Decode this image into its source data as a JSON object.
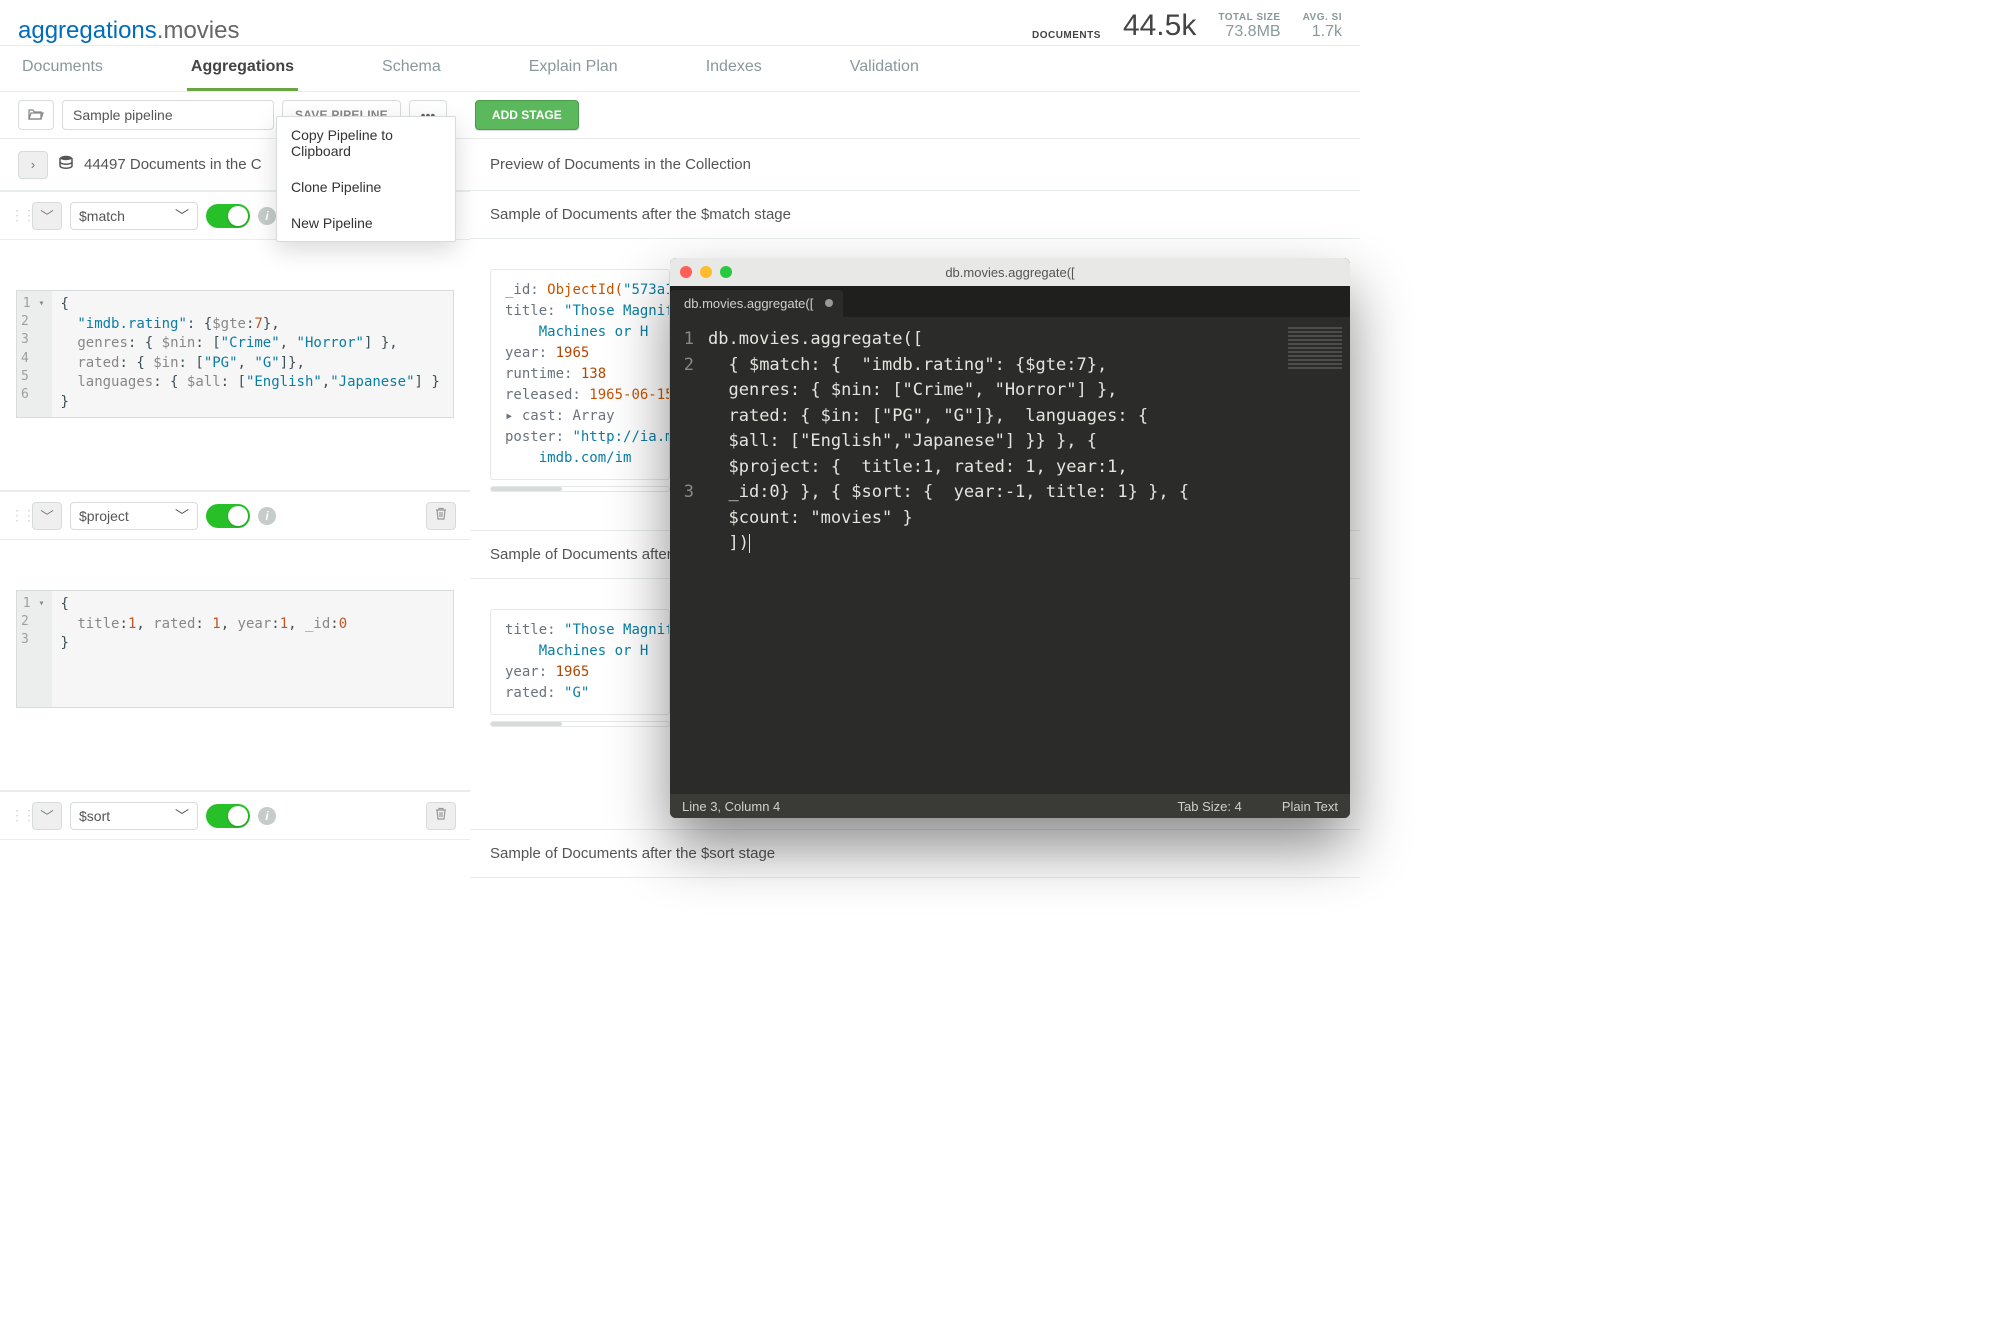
{
  "header": {
    "db": "aggregations",
    "collection": "movies",
    "stats": {
      "documents_label": "DOCUMENTS",
      "documents_value": "44.5k",
      "total_size_label": "TOTAL SIZE",
      "total_size_value": "73.8MB",
      "avg_size_label": "AVG. SI",
      "avg_size_value": "1.7k"
    }
  },
  "tabs": [
    "Documents",
    "Aggregations",
    "Schema",
    "Explain Plan",
    "Indexes",
    "Validation"
  ],
  "active_tab": "Aggregations",
  "toolbar": {
    "pipeline_name": "Sample pipeline",
    "save_label": "SAVE PIPELINE",
    "add_stage_label": "ADD STAGE",
    "dropdown": [
      "Copy Pipeline to Clipboard",
      "Clone Pipeline",
      "New Pipeline"
    ]
  },
  "doc_header": {
    "left": "44497 Documents in the C",
    "right": "Preview of Documents in the Collection"
  },
  "stages": [
    {
      "operator": "$match",
      "sample_label": "Sample of Documents after the $match stage",
      "editor_lines": [
        "{",
        "  \"imdb.rating\": {$gte:7},",
        "  genres: { $nin: [\"Crime\", \"Horror\"] },",
        "  rated: { $in: [\"PG\", \"G\"]},",
        "  languages: { $all: [\"English\",\"Japanese\"] }",
        "}"
      ],
      "preview": {
        "id_label": "_id:",
        "id_fn": "ObjectId(",
        "id_val": "\"573a1",
        "title_label": "title:",
        "title_val": "\"Those Magnif",
        "title_cont": "Machines or H",
        "year_label": "year:",
        "year_val": "1965",
        "runtime_label": "runtime:",
        "runtime_val": "138",
        "released_label": "released:",
        "released_val": "1965-06-15",
        "cast_label": "cast:",
        "cast_val": "Array",
        "poster_label": "poster:",
        "poster_val": "\"http://ia.m",
        "poster_cont": "imdb.com/im"
      }
    },
    {
      "operator": "$project",
      "sample_label": "Sample of Documents after the",
      "editor_lines": [
        "{",
        "  title:1, rated: 1, year:1, _id:0",
        "}"
      ],
      "preview": {
        "title_label": "title:",
        "title_val": "\"Those Magnif",
        "title_cont": "Machines or H",
        "year_label": "year:",
        "year_val": "1965",
        "rated_label": "rated:",
        "rated_val": "\"G\""
      }
    },
    {
      "operator": "$sort",
      "sample_label": "Sample of Documents after the $sort stage"
    }
  ],
  "editor_window": {
    "title": "db.movies.aggregate([",
    "tab": "db.movies.aggregate([",
    "gutter": [
      "1",
      "2",
      "",
      "",
      "",
      "",
      "",
      "3"
    ],
    "code": "db.movies.aggregate([\n  { $match: {  \"imdb.rating\": {$gte:7},\n  genres: { $nin: [\"Crime\", \"Horror\"] },\n  rated: { $in: [\"PG\", \"G\"]},  languages: {\n  $all: [\"English\",\"Japanese\"] }} }, {\n  $project: {  title:1, rated: 1, year:1,\n  _id:0} }, { $sort: {  year:-1, title: 1} }, {\n  $count: \"movies\" }\n  ])",
    "status_left": "Line 3, Column 4",
    "status_tab": "Tab Size: 4",
    "status_lang": "Plain Text"
  }
}
